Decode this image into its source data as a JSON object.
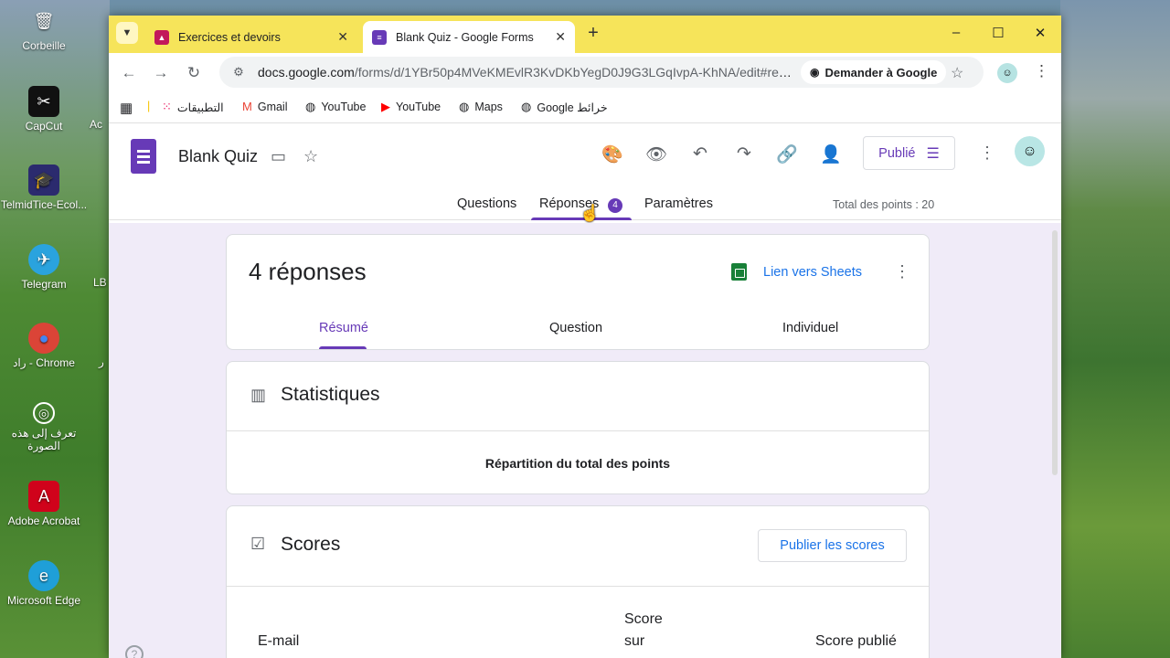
{
  "desktop": {
    "icons": [
      {
        "label": "Corbeille",
        "glyph": "🗑"
      },
      {
        "label": "CapCut",
        "glyph": "✂"
      },
      {
        "label": "TelmidTice-Ecol...",
        "glyph": "🎓"
      },
      {
        "label": "Telegram",
        "glyph": "✈"
      },
      {
        "label": "راد - Chrome",
        "glyph": "●"
      },
      {
        "label": "تعرف إلى هذه الصورة",
        "glyph": "◎"
      },
      {
        "label": "Adobe Acrobat",
        "glyph": "A"
      },
      {
        "label": "Microsoft Edge",
        "glyph": "e"
      }
    ],
    "peek_labels": [
      "Ac",
      "LB",
      "ر"
    ]
  },
  "browser": {
    "tabs": [
      {
        "title": "Exercices et devoirs",
        "fav_color": "#c2185b"
      },
      {
        "title": "Blank Quiz - Google Forms",
        "fav_color": "#673ab7"
      }
    ],
    "new_tab": "+",
    "window_controls": {
      "minimize": "–",
      "maximize": "☐",
      "close": "✕"
    },
    "url_host": "docs.google.com",
    "url_path": "/forms/d/1YBr50p4MVeKMEvlR3KvDKbYegD0J9G3LGqIvpA-KhNA/edit#resp...",
    "ask_google": "Demander à Google",
    "bookmarks": [
      {
        "label": "التطبيقات",
        "icon": "apps-grid-icon"
      },
      {
        "label": "Gmail",
        "icon": "gmail-icon"
      },
      {
        "label": "YouTube",
        "icon": "globe-icon"
      },
      {
        "label": "YouTube",
        "icon": "youtube-icon"
      },
      {
        "label": "Maps",
        "icon": "globe-icon"
      },
      {
        "label": "Google خرائط",
        "icon": "globe-icon"
      }
    ]
  },
  "forms": {
    "doc_title": "Blank Quiz",
    "publish_label": "Publié",
    "tabs": {
      "questions": "Questions",
      "responses": "Réponses",
      "responses_count": "4",
      "settings": "Paramètres"
    },
    "total_points": "Total des points : 20",
    "responses_card": {
      "count_label": "4 réponses",
      "sheets_link": "Lien vers Sheets",
      "subtabs": [
        "Résumé",
        "Question",
        "Individuel"
      ]
    },
    "stats_card": {
      "title": "Statistiques",
      "chart_title": "Répartition du total des points"
    },
    "scores_card": {
      "title": "Scores",
      "publish_button": "Publier les scores",
      "col_email": "E-mail",
      "col_score_line1": "Score",
      "col_score_line2": "sur",
      "col_published": "Score publié"
    },
    "colors": {
      "accent": "#673ab7",
      "link": "#1a73e8",
      "background": "#f0ebf8"
    }
  }
}
